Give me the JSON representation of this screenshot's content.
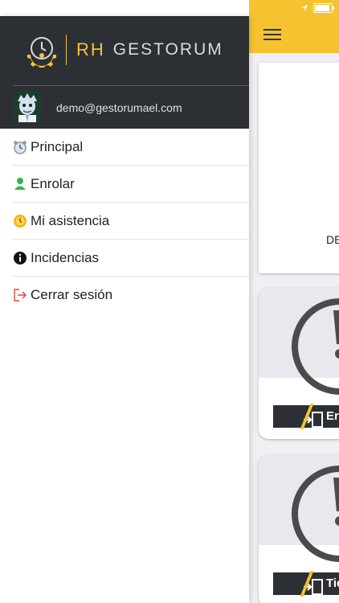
{
  "drawer": {
    "brand_prefix": "RH",
    "brand_name": "GESTORUM",
    "user_email": "demo@gestorumael.com",
    "menu": [
      {
        "label": "Principal",
        "icon": "alarm-clock-icon",
        "icon_color": "#8a9aa8"
      },
      {
        "label": "Enrolar",
        "icon": "person-icon",
        "icon_color": "#2eb84a"
      },
      {
        "label": "Mi asistencia",
        "icon": "clock-icon",
        "icon_color": "#f2b40f"
      },
      {
        "label": "Incidencias",
        "icon": "info-icon",
        "icon_color": "#111111"
      },
      {
        "label": "Cerrar sesión",
        "icon": "logout-icon",
        "icon_color": "#e2453b"
      }
    ]
  },
  "app": {
    "card_text": "DE",
    "cards": [
      {
        "action_label": "Er"
      },
      {
        "action_label": "Tier"
      }
    ]
  },
  "colors": {
    "accent": "#f5c330",
    "drawer_header": "#2c3034",
    "dark_bar": "#2c2f33"
  }
}
